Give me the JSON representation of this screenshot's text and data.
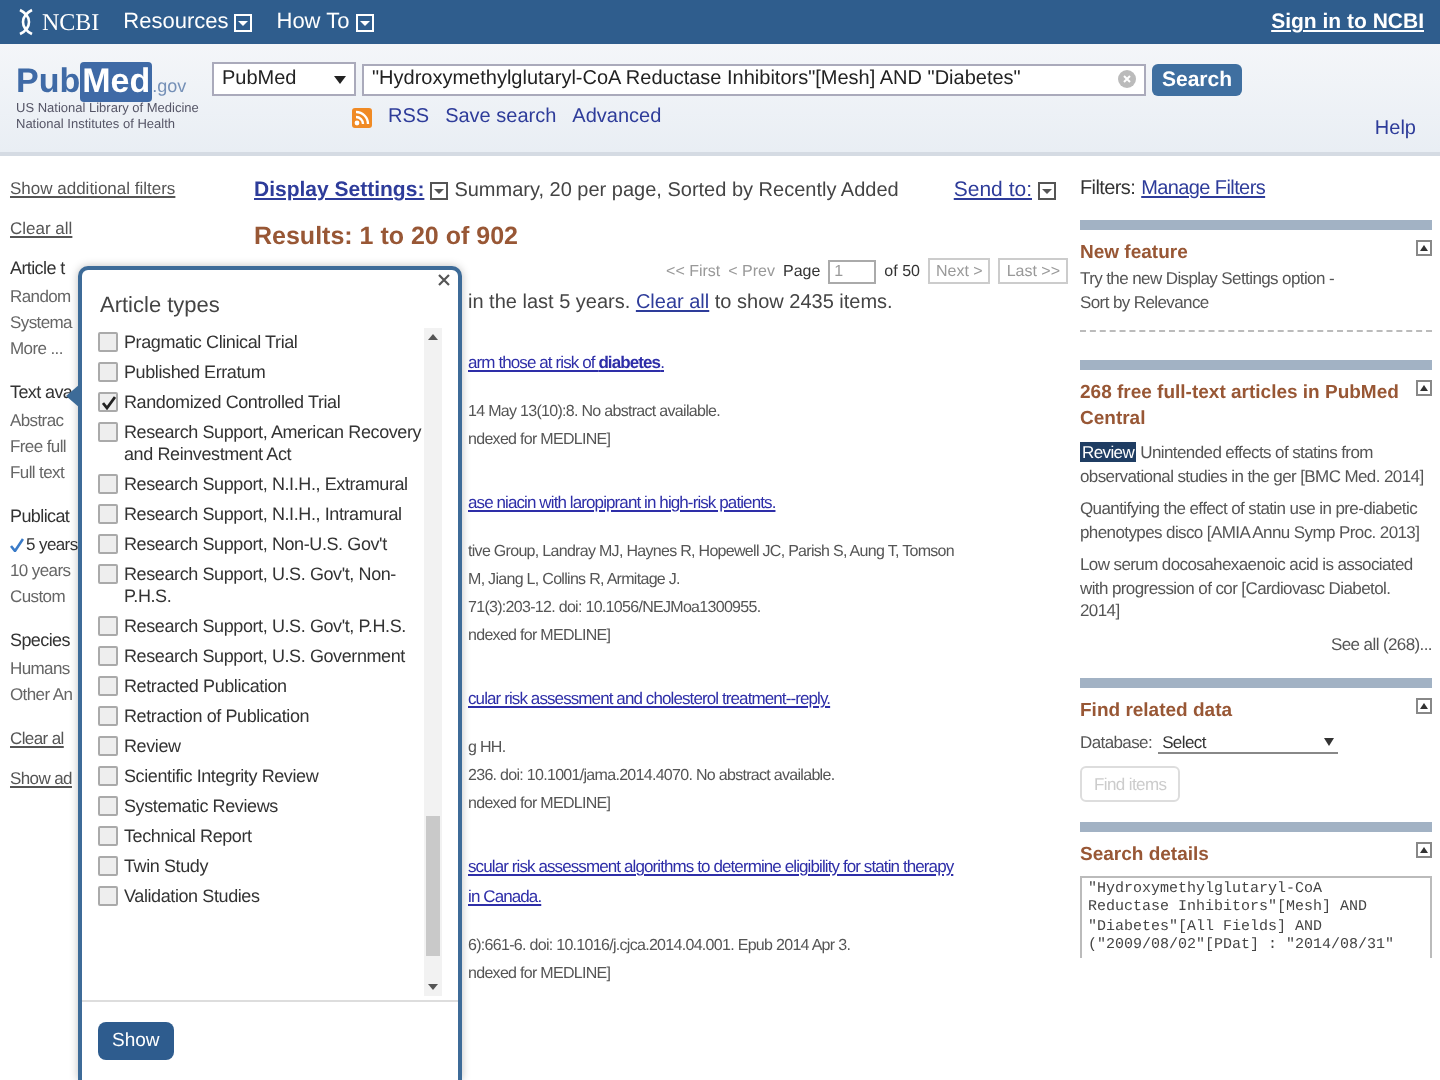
{
  "header": {
    "logo": "NCBI",
    "menus": [
      {
        "label": "Resources"
      },
      {
        "label": "How To"
      }
    ],
    "sign_in": "Sign in to NCBI"
  },
  "search": {
    "logo": "Pub",
    "logo_mark": "Med",
    "logo_suffix": ".gov",
    "org_lines": [
      "US National Library of Medicine",
      "National Institutes of Health"
    ],
    "database": "PubMed",
    "query": "\"Hydroxymethylglutaryl-CoA Reductase Inhibitors\"[Mesh] AND \"Diabetes\"",
    "button": "Search",
    "links": [
      "RSS",
      "Save search",
      "Advanced"
    ],
    "help": "Help"
  },
  "sidebar": {
    "top_links": [
      "Show additional filters",
      "Clear all"
    ],
    "groups": [
      {
        "title": "Article t",
        "items": [
          {
            "label": "Random",
            "selected": false
          },
          {
            "label": "Systema",
            "selected": false
          },
          {
            "label": "More ...",
            "selected": false
          }
        ]
      },
      {
        "title": "Text ava",
        "items": [
          {
            "label": "Abstrac",
            "selected": false
          },
          {
            "label": "Free full",
            "selected": false
          },
          {
            "label": "Full text",
            "selected": false
          }
        ]
      },
      {
        "title": "Publicat",
        "items": [
          {
            "label": "5 years",
            "selected": true
          },
          {
            "label": "10 years",
            "selected": false
          },
          {
            "label": "Custom",
            "selected": false
          }
        ]
      },
      {
        "title": "Species",
        "items": [
          {
            "label": "Humans",
            "selected": false
          },
          {
            "label": "Other An",
            "selected": false
          }
        ]
      }
    ],
    "bottom_links": [
      "Clear al",
      "Show ad"
    ]
  },
  "results": {
    "display_label": "Display Settings:",
    "display_value": "Summary, 20 per page, Sorted by Recently Added",
    "send_to": "Send to:",
    "heading": "Results: 1 to 20 of 902",
    "pager": {
      "first": "<< First",
      "prev": "< Prev",
      "page_label": "Page",
      "page": "1",
      "of": "of 50",
      "next": "Next >",
      "last": "Last >>"
    },
    "notice_before": "in the last 5 years.",
    "notice_link": "Clear all",
    "notice_after": "to show 2435 items.",
    "items": [
      {
        "title_lines": [
          "arm those at risk of **diabetes**."
        ],
        "lines": [
          "14 May 13(10):8. No abstract available.",
          "ndexed for MEDLINE]"
        ]
      },
      {
        "title_lines": [
          "ase niacin with laropiprant in high-risk patients."
        ],
        "lines": [
          "tive Group, Landray MJ, Haynes R, Hopewell JC, Parish S, Aung T, Tomson",
          "M, Jiang L, Collins R, Armitage J.",
          "71(3):203-12. doi: 10.1056/NEJMoa1300955.",
          "ndexed for MEDLINE]"
        ]
      },
      {
        "title_lines": [
          "cular risk assessment and cholesterol treatment--reply."
        ],
        "lines": [
          "g HH.",
          "236. doi: 10.1001/jama.2014.4070. No abstract available.",
          "ndexed for MEDLINE]"
        ]
      },
      {
        "title_lines": [
          "scular risk assessment algorithms to determine eligibility for statin therapy",
          "in Canada."
        ],
        "lines": [
          "6):661-6. doi: 10.1016/j.cjca.2014.04.001. Epub 2014 Apr 3.",
          "ndexed for MEDLINE]"
        ]
      }
    ]
  },
  "right": {
    "filters_label": "Filters:",
    "manage_filters": "Manage Filters",
    "feature": {
      "title": "New feature",
      "text_lines": [
        "Try the new Display Settings option -",
        "Sort by Relevance"
      ]
    },
    "pmc": {
      "title": "268 free full-text articles in PubMed Central",
      "articles": [
        {
          "badge": "Review",
          "text": "Unintended effects of statins from observational studies in the ger [BMC Med. 2014]"
        },
        {
          "text": "Quantifying the effect of statin use in pre-diabetic phenotypes disco [AMIA Annu Symp Proc. 2013]"
        },
        {
          "text": "Low serum docosahexaenoic acid is associated with progression of cor [Cardiovasc Diabetol. 2014]"
        }
      ],
      "see_all": "See all (268)..."
    },
    "related": {
      "title": "Find related data",
      "db_label": "Database:",
      "db_value": "Select",
      "button": "Find items",
      "button_disabled": true
    },
    "details": {
      "title": "Search details",
      "query_lines": [
        "\"Hydroxymethylglutaryl-CoA",
        "Reductase Inhibitors\"[Mesh] AND",
        "\"Diabetes\"[All Fields] AND",
        "(\"2009/08/02\"[PDat] : \"2014/08/31\""
      ]
    }
  },
  "popup": {
    "title": "Article types",
    "items": [
      {
        "label": "Pragmatic Clinical Trial",
        "checked": false
      },
      {
        "label": "Published Erratum",
        "checked": false
      },
      {
        "label": "Randomized Controlled Trial",
        "checked": true
      },
      {
        "label": "Research Support, American Recovery and Reinvestment Act",
        "checked": false
      },
      {
        "label": "Research Support, N.I.H., Extramural",
        "checked": false
      },
      {
        "label": "Research Support, N.I.H., Intramural",
        "checked": false
      },
      {
        "label": "Research Support, Non-U.S. Gov't",
        "checked": false
      },
      {
        "label": "Research Support, U.S. Gov't, Non-P.H.S.",
        "checked": false
      },
      {
        "label": "Research Support, U.S. Gov't, P.H.S.",
        "checked": false
      },
      {
        "label": "Research Support, U.S. Government",
        "checked": false
      },
      {
        "label": "Retracted Publication",
        "checked": false
      },
      {
        "label": "Retraction of Publication",
        "checked": false
      },
      {
        "label": "Review",
        "checked": false
      },
      {
        "label": "Scientific Integrity Review",
        "checked": false
      },
      {
        "label": "Systematic Reviews",
        "checked": false
      },
      {
        "label": "Technical Report",
        "checked": false
      },
      {
        "label": "Twin Study",
        "checked": false
      },
      {
        "label": "Validation Studies",
        "checked": false
      }
    ],
    "button": "Show"
  }
}
